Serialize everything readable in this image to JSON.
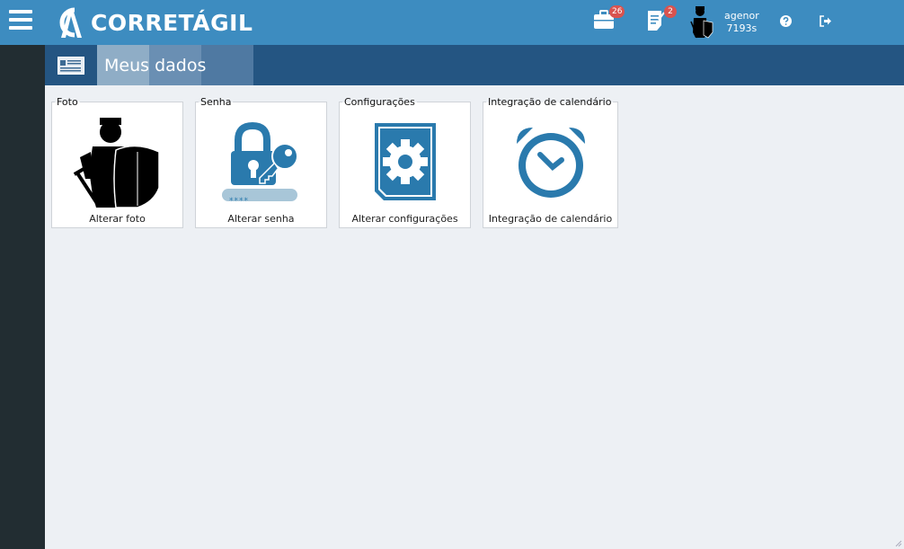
{
  "app": {
    "brand": "CORRETÁGIL"
  },
  "header": {
    "briefcase_badge": "26",
    "tasks_badge": "2",
    "user": {
      "name": "agenor",
      "time": "7193s"
    },
    "icons": [
      "menu-icon",
      "briefcase-icon",
      "tasks-icon",
      "avatar",
      "help-icon",
      "logout-icon"
    ]
  },
  "page": {
    "title": "Meus dados"
  },
  "cards": [
    {
      "legend": "Foto",
      "caption": "Alterar foto",
      "icon": "knight-icon"
    },
    {
      "legend": "Senha",
      "caption": "Alterar senha",
      "icon": "lock-key-icon",
      "password_mask": "****"
    },
    {
      "legend": "Configurações",
      "caption": "Alterar configurações",
      "icon": "settings-document-icon"
    },
    {
      "legend": "Integração de calendário",
      "caption": "Integração de calendário",
      "icon": "alarm-clock-icon"
    }
  ],
  "colors": {
    "topbar": "#3d8cc0",
    "titlebar": "#245582",
    "sidebar": "#222d32",
    "accent_icon": "#2a7aad",
    "badge": "#d9534f"
  }
}
